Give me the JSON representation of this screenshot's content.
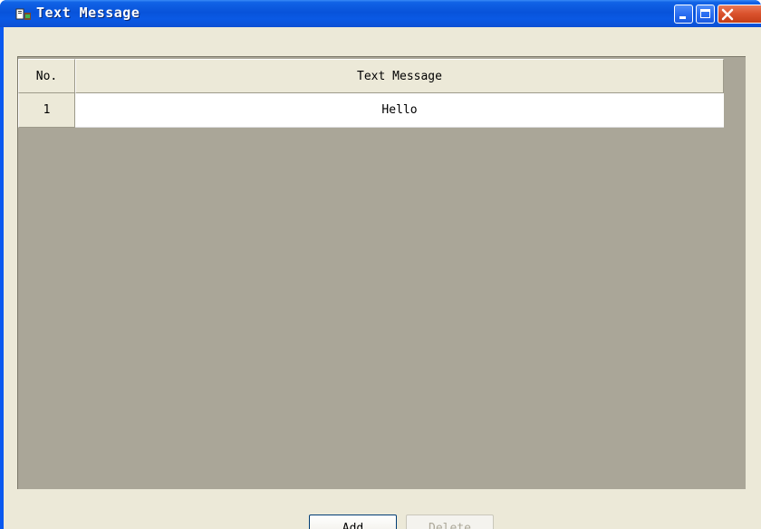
{
  "window": {
    "title": "Text Message",
    "controls": {
      "minimize": "minimize",
      "maximize": "maximize",
      "close": "close"
    },
    "colors": {
      "titlebar": "#0853da",
      "close_button": "#d9512c",
      "client_bg": "#ece9d8",
      "table_bg": "#aaa698"
    }
  },
  "table": {
    "columns": [
      "No.",
      "Text Message"
    ],
    "rows": [
      {
        "no": "1",
        "message": "Hello"
      }
    ]
  },
  "buttons": {
    "add": "Add",
    "delete": "Delete"
  },
  "icons": {
    "app": "app-icon",
    "minimize": "minimize-icon",
    "maximize": "maximize-icon",
    "close": "close-icon"
  }
}
